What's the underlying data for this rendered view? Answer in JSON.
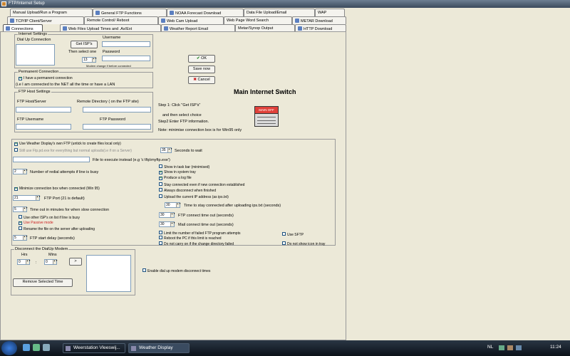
{
  "window": {
    "title": "FTP/Internet Setup"
  },
  "tabs_row1": [
    "Manual Upload/Run a Program",
    "General FTP Functions",
    "NOAA Forecast Download",
    "Data File Upload/Email",
    "WAP"
  ],
  "tabs_row2": [
    "TCP/IP Client/Server",
    "Remote Control/ Reboot",
    "Web Cam Upload",
    "Web Page Word Search",
    "METAR Download"
  ],
  "tabs_row3": [
    "Connections",
    "Web Files Upload Times and .Ax/Ext",
    "Weather Report Email",
    "Metar/Synop Output",
    "HTTP Download"
  ],
  "internet_settings": {
    "legend": "Internet Settings",
    "dialup_label": "Dial Up Connection",
    "get_isps_button": "Get ISP's",
    "then_select_label": "Then select one",
    "spin_value": "13",
    "username_label": "Username",
    "password_label": "Password",
    "modem_note": "Modem change if before connected"
  },
  "permanent": {
    "legend": "Permanent Connection",
    "checkbox": "I have a permanent connection",
    "note": "(i.e I am connected to the NET all the time or have a LAN"
  },
  "ftp_host": {
    "legend": "FTP Host Settings",
    "host_label": "FTP Host/Server",
    "remote_dir_label": "Remote Directory ( on the FTP site)",
    "username_label": "FTP Username",
    "password_label": "FTP Password"
  },
  "buttons": {
    "ok": "OK",
    "save": "Save now",
    "cancel": "Cancel"
  },
  "switch": {
    "title": "Main Internet Switch",
    "step1": "Step 1: Click  \"Get ISP's\"",
    "then_select": "and then select choice",
    "step2": "Step2  Enter FTP information.",
    "note": "Note: minimise connection box is for Win95 only",
    "button_label": "MAIN OFF"
  },
  "options": {
    "use_own_ftp": "Use Weather Display's own FTP  (untick to create files local only)",
    "still_use_ftp": "Still use Ftp.pd.exe for everything but normal uploads(i.e if on a Server)",
    "seconds_wait_value": "35",
    "seconds_wait_label": "Seconds to wait",
    "file_execute_label": "File to execute instead (e.g 'c:\\ftp\\myftp.exe')",
    "redial_value": "2",
    "redial_label": "Number of redial attempts if line is busy",
    "minimize_box": "Minimize connection box when connected (Win 95)",
    "port_value": "21",
    "port_label": "FTP Port (21 is default)",
    "timeout_value": "5",
    "timeout_label": "Time out in minutes for when slow connection",
    "use_other_isps": "Use other ISP's on list if line is busy",
    "use_passive": "Use Passive mode",
    "rename_file": "Rename the file on the server after uploading",
    "start_delay_value": "5",
    "start_delay_label": "FTP start delay (seconds)",
    "show_taskbar": "Show in task bar (minimised)",
    "show_tray": "Show in system tray",
    "produce_log": "Produce a log file",
    "stay_connected": "Stay connected even if new connection established",
    "always_disconnect": "Always disconnect when finished",
    "upload_ip": "Upload the current IP address (as ips.txt)",
    "stay_after_value": "30",
    "stay_after_label": "Time to stay connected after uploading ips.txt (seconds)",
    "ftp_connect_value": "30",
    "ftp_connect_label": "FTP connect time out (seconds)",
    "mail_connect_value": "30",
    "mail_connect_label": "Mail connect time out (seconds)",
    "limit_failed": "Limit the number of failed FTP program attempts",
    "reboot_pc": "Reboot the PC if this limit is reached",
    "do_not_carry": "Do not carry on if the change directory failed",
    "use_sftp": "Use SFTP",
    "no_tray_icon": "Do not show icon in tray"
  },
  "disconnect": {
    "legend": "Disconnect the DialUp Modem",
    "hrs_label": "Hrs",
    "mins_label": "Mins",
    "hrs_value": "0",
    "mins_value": "0",
    "add_button": ">",
    "remove_button": "Remove Selected Time",
    "enable_label": "Enable dial up modem disconnect times"
  },
  "taskbar": {
    "task1": "Weerstation Vleeswij...",
    "task2": "Weather Display",
    "lang": "NL",
    "clock": "11:24"
  },
  "colors": {
    "window_bg": "#ece9d8",
    "switch_red": "#e0403a",
    "accent_green": "#2a8a2a"
  }
}
